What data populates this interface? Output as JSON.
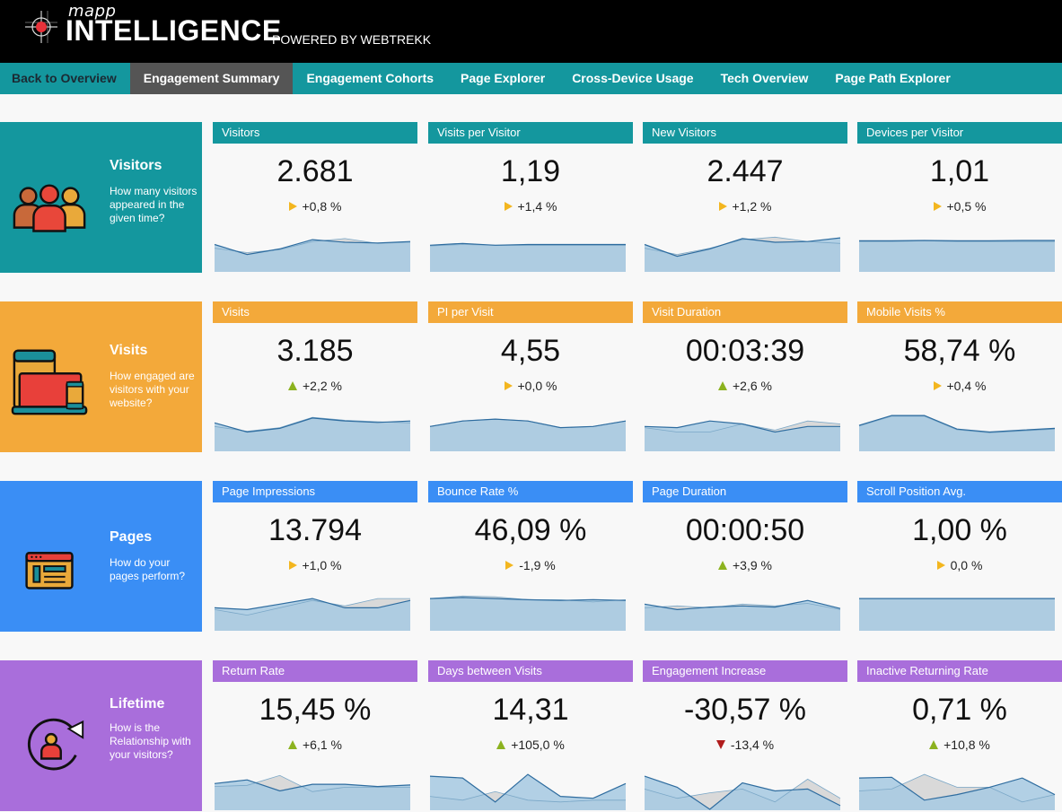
{
  "header": {
    "brand_small": "mapp",
    "brand_big": "INTELLIGENCE",
    "powered_by": "POWERED BY WEBTREKK"
  },
  "nav": {
    "items": [
      {
        "label": "Back to Overview",
        "state": "back"
      },
      {
        "label": "Engagement Summary",
        "state": "active"
      },
      {
        "label": "Engagement Cohorts",
        "state": ""
      },
      {
        "label": "Page Explorer",
        "state": ""
      },
      {
        "label": "Cross-Device Usage",
        "state": ""
      },
      {
        "label": "Tech Overview",
        "state": ""
      },
      {
        "label": "Page Path Explorer",
        "state": ""
      }
    ]
  },
  "colors": {
    "visitors": "#14979e",
    "visits": "#f3a93a",
    "pages": "#3a8ef5",
    "lifetime": "#a96edb",
    "trend_flat": "#f3b61f",
    "trend_up": "#8cb21f",
    "trend_down": "#b01c1c",
    "spark_fill": "#a6c9e2",
    "spark_line": "#2e6c9f",
    "spark_prev": "#d9d9d9"
  },
  "sections": [
    {
      "key": "visitors",
      "icon": "people-group-icon",
      "title": "Visitors",
      "description": "How many visitors appeared in the given time?",
      "cards": [
        {
          "title": "Visitors",
          "value": "2.681",
          "trend": "flat",
          "change": "+0,8 %",
          "series": [
            0.72,
            0.45,
            0.6,
            0.85,
            0.78,
            0.76,
            0.8
          ],
          "prev": [
            0.62,
            0.5,
            0.58,
            0.8,
            0.88,
            0.75,
            0.78
          ]
        },
        {
          "title": "Visits per Visitor",
          "value": "1,19",
          "trend": "flat",
          "change": "+1,4 %",
          "series": [
            0.7,
            0.75,
            0.7,
            0.72,
            0.72,
            0.72,
            0.72
          ],
          "prev": [
            0.68,
            0.72,
            0.7,
            0.7,
            0.7,
            0.7,
            0.7
          ]
        },
        {
          "title": "New Visitors",
          "value": "2.447",
          "trend": "flat",
          "change": "+1,2 %",
          "series": [
            0.72,
            0.4,
            0.6,
            0.88,
            0.78,
            0.8,
            0.9
          ],
          "prev": [
            0.62,
            0.45,
            0.62,
            0.85,
            0.92,
            0.8,
            0.75
          ]
        },
        {
          "title": "Devices per Visitor",
          "value": "1,01",
          "trend": "flat",
          "change": "+0,5 %",
          "series": [
            0.82,
            0.82,
            0.83,
            0.82,
            0.82,
            0.83,
            0.83
          ],
          "prev": [
            0.8,
            0.8,
            0.82,
            0.8,
            0.8,
            0.8,
            0.8
          ]
        }
      ]
    },
    {
      "key": "visits",
      "icon": "devices-icon",
      "title": "Visits",
      "description": "How engaged are visitors with your website?",
      "cards": [
        {
          "title": "Visits",
          "value": "3.185",
          "trend": "up",
          "change": "+2,2 %",
          "series": [
            0.75,
            0.5,
            0.6,
            0.88,
            0.8,
            0.76,
            0.8
          ],
          "prev": [
            0.65,
            0.52,
            0.62,
            0.9,
            0.82,
            0.78,
            0.75
          ]
        },
        {
          "title": "PI per Visit",
          "value": "4,55",
          "trend": "flat",
          "change": "+0,0 %",
          "series": [
            0.65,
            0.8,
            0.85,
            0.8,
            0.62,
            0.65,
            0.8
          ],
          "prev": [
            0.65,
            0.8,
            0.85,
            0.8,
            0.62,
            0.65,
            0.8
          ]
        },
        {
          "title": "Visit Duration",
          "value": "00:03:39",
          "trend": "up",
          "change": "+2,6 %",
          "series": [
            0.65,
            0.62,
            0.8,
            0.72,
            0.5,
            0.65,
            0.65
          ],
          "prev": [
            0.62,
            0.5,
            0.5,
            0.72,
            0.55,
            0.8,
            0.72
          ]
        },
        {
          "title": "Mobile Visits %",
          "value": "58,74 %",
          "trend": "flat",
          "change": "+0,4 %",
          "series": [
            0.68,
            0.95,
            0.95,
            0.58,
            0.5,
            0.55,
            0.6
          ],
          "prev": [
            0.66,
            0.93,
            0.93,
            0.56,
            0.48,
            0.53,
            0.58
          ]
        }
      ]
    },
    {
      "key": "pages",
      "icon": "browser-window-icon",
      "title": "Pages",
      "description": "How do your pages perform?",
      "cards": [
        {
          "title": "Page Impressions",
          "value": "13.794",
          "trend": "flat",
          "change": "+1,0 %",
          "series": [
            0.6,
            0.55,
            0.7,
            0.85,
            0.6,
            0.6,
            0.8
          ],
          "prev": [
            0.55,
            0.4,
            0.6,
            0.8,
            0.65,
            0.85,
            0.85
          ]
        },
        {
          "title": "Bounce Rate %",
          "value": "46,09 %",
          "trend": "flat",
          "change": "-1,9 %",
          "series": [
            0.85,
            0.88,
            0.85,
            0.82,
            0.8,
            0.82,
            0.8
          ],
          "prev": [
            0.85,
            0.92,
            0.9,
            0.82,
            0.82,
            0.76,
            0.82
          ]
        },
        {
          "title": "Page Duration",
          "value": "00:00:50",
          "trend": "up",
          "change": "+3,9 %",
          "series": [
            0.7,
            0.55,
            0.62,
            0.65,
            0.62,
            0.8,
            0.58
          ],
          "prev": [
            0.6,
            0.65,
            0.6,
            0.7,
            0.65,
            0.72,
            0.55
          ]
        },
        {
          "title": "Scroll Position Avg.",
          "value": "1,00 %",
          "trend": "flat",
          "change": "0,0 %",
          "series": [
            0.85,
            0.85,
            0.85,
            0.85,
            0.85,
            0.85,
            0.85
          ],
          "prev": [
            0.85,
            0.85,
            0.85,
            0.85,
            0.85,
            0.85,
            0.85
          ]
        }
      ]
    },
    {
      "key": "lifetime",
      "icon": "user-cycle-icon",
      "title": "Lifetime",
      "description": "How is the Relationship with your visitors?",
      "cards": [
        {
          "title": "Return Rate",
          "value": "15,45 %",
          "trend": "up",
          "change": "+6,1 %",
          "series": [
            0.7,
            0.8,
            0.5,
            0.68,
            0.68,
            0.62,
            0.66
          ],
          "prev": [
            0.62,
            0.65,
            0.92,
            0.48,
            0.6,
            0.6,
            0.6
          ]
        },
        {
          "title": "Days between Visits",
          "value": "14,31",
          "trend": "up",
          "change": "+105,0 %",
          "series": [
            0.9,
            0.85,
            0.2,
            0.95,
            0.35,
            0.3,
            0.7
          ],
          "prev": [
            0.35,
            0.25,
            0.48,
            0.25,
            0.2,
            0.25,
            0.25
          ]
        },
        {
          "title": "Engagement Increase",
          "value": "-30,57 %",
          "trend": "down",
          "change": "-13,4 %",
          "series": [
            0.9,
            0.6,
            0.0,
            0.72,
            0.5,
            0.55,
            0.1
          ],
          "prev": [
            0.55,
            0.3,
            0.45,
            0.55,
            0.2,
            0.82,
            0.3
          ]
        },
        {
          "title": "Inactive Returning Rate",
          "value": "0,71 %",
          "trend": "up",
          "change": "+10,8 %",
          "series": [
            0.85,
            0.87,
            0.25,
            0.4,
            0.6,
            0.85,
            0.4
          ],
          "prev": [
            0.5,
            0.55,
            0.95,
            0.6,
            0.6,
            0.2,
            0.4
          ]
        }
      ]
    }
  ]
}
